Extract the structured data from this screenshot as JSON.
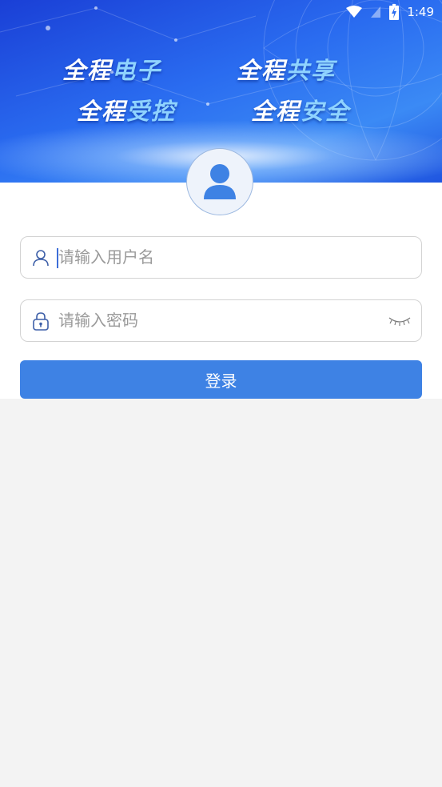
{
  "status_bar": {
    "time": "1:49",
    "icons": [
      "wifi-icon",
      "signal-icon",
      "battery-charging-icon"
    ]
  },
  "banner": {
    "slogans": [
      {
        "prefix": "全程",
        "highlight": "电子"
      },
      {
        "prefix": "全程",
        "highlight": "共享"
      },
      {
        "prefix": "全程",
        "highlight": "受控"
      },
      {
        "prefix": "全程",
        "highlight": "安全"
      }
    ],
    "colors": {
      "slogan_white": "#ffffff",
      "slogan_highlight": "#8fd3ff",
      "banner_blue": "#2a6cf0"
    }
  },
  "avatar": {
    "icon": "user-avatar-icon"
  },
  "login_form": {
    "username": {
      "placeholder": "请输入用户名",
      "value": "",
      "icon": "user-icon"
    },
    "password": {
      "placeholder": "请输入密码",
      "value": "",
      "icon": "lock-icon",
      "toggle_icon": "eye-closed-icon"
    },
    "submit_label": "登录"
  },
  "colors": {
    "accent": "#3e82e4",
    "page_bg": "#f3f3f3"
  }
}
